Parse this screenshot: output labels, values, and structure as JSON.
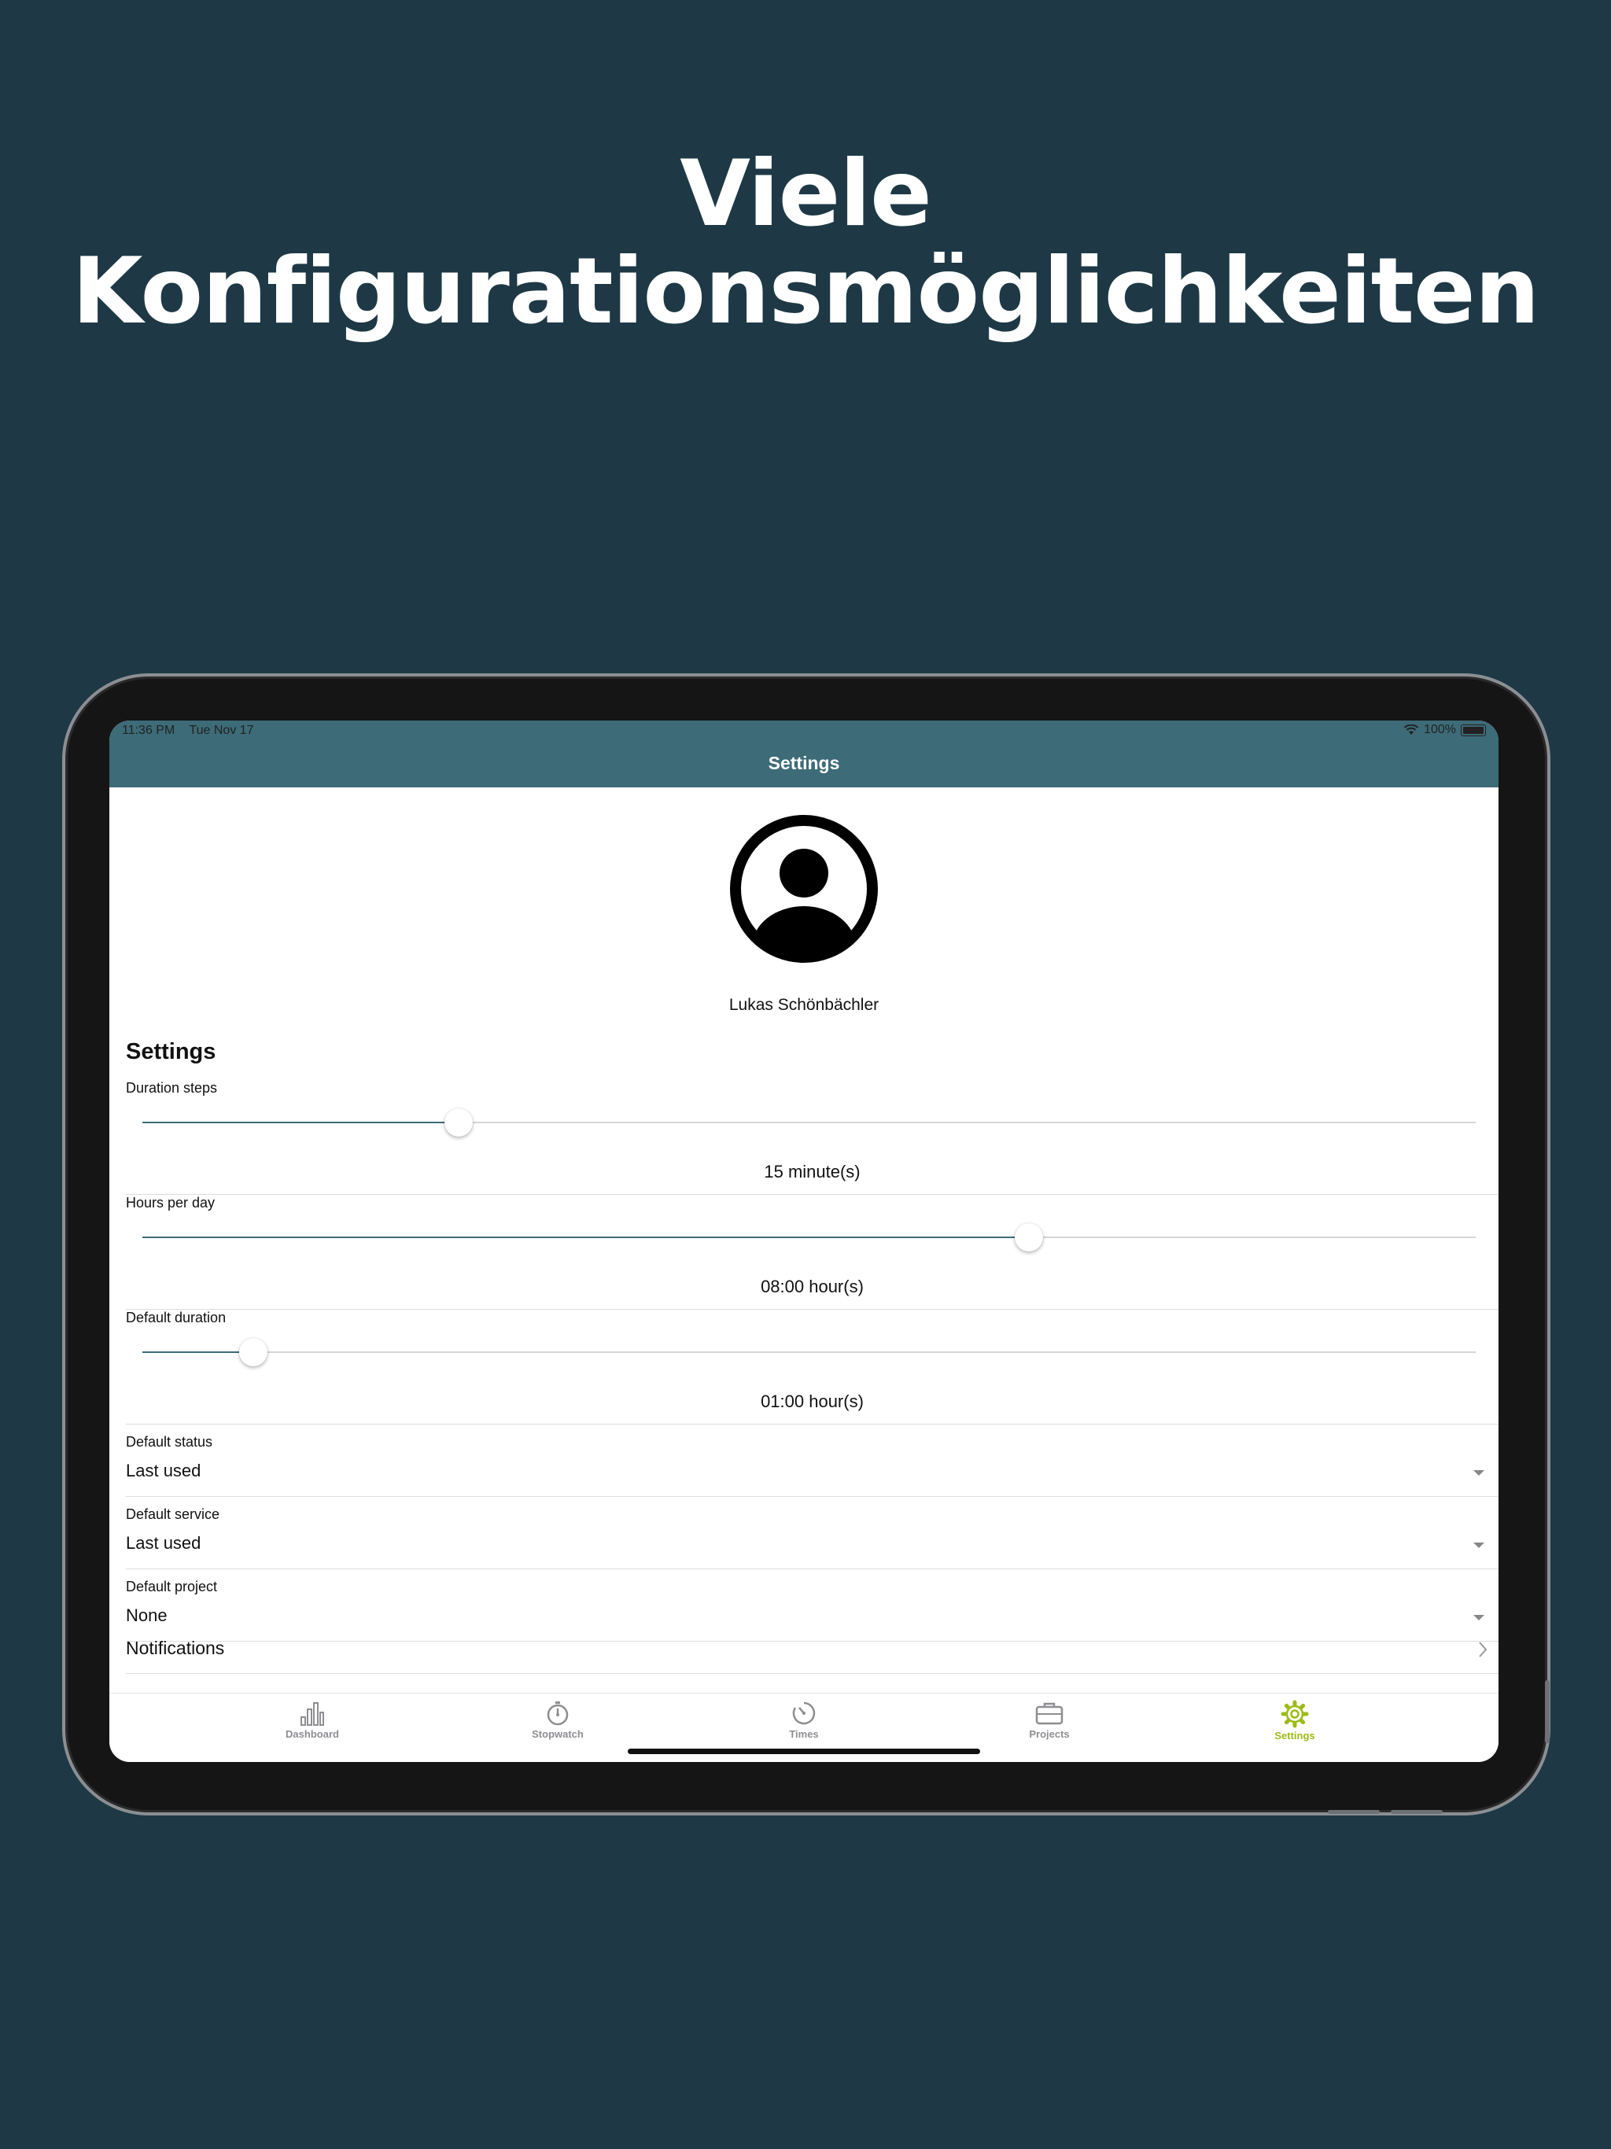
{
  "headline": {
    "line1": "Viele",
    "line2": "Konfigurationsmöglichkeiten"
  },
  "status_bar": {
    "time": "11:36 PM",
    "date": "Tue Nov 17",
    "battery": "100%"
  },
  "nav": {
    "title": "Settings"
  },
  "profile": {
    "name": "Lukas Schönbächler",
    "avatar_icon": "account-circle-icon"
  },
  "settings": {
    "section_title": "Settings",
    "sliders": [
      {
        "label": "Duration steps",
        "value_text": "15 minute(s)",
        "fraction": 0.237
      },
      {
        "label": "Hours per day",
        "value_text": "08:00 hour(s)",
        "fraction": 0.665
      },
      {
        "label": "Default duration",
        "value_text": "01:00 hour(s)",
        "fraction": 0.083
      }
    ],
    "selects": [
      {
        "label": "Default status",
        "value": "Last used"
      },
      {
        "label": "Default service",
        "value": "Last used"
      },
      {
        "label": "Default project",
        "value": "None"
      }
    ],
    "notifications_label": "Notifications"
  },
  "tabs": [
    {
      "label": "Dashboard",
      "icon": "bar-chart-icon",
      "active": false
    },
    {
      "label": "Stopwatch",
      "icon": "stopwatch-icon",
      "active": false
    },
    {
      "label": "Times",
      "icon": "clock-icon",
      "active": false
    },
    {
      "label": "Projects",
      "icon": "briefcase-icon",
      "active": false
    },
    {
      "label": "Settings",
      "icon": "gear-icon",
      "active": true
    }
  ],
  "colors": {
    "background": "#1e3945",
    "nav_bar": "#3d6b78",
    "accent_active_tab": "#9cbb16",
    "inactive_tab": "#8e8e93"
  }
}
